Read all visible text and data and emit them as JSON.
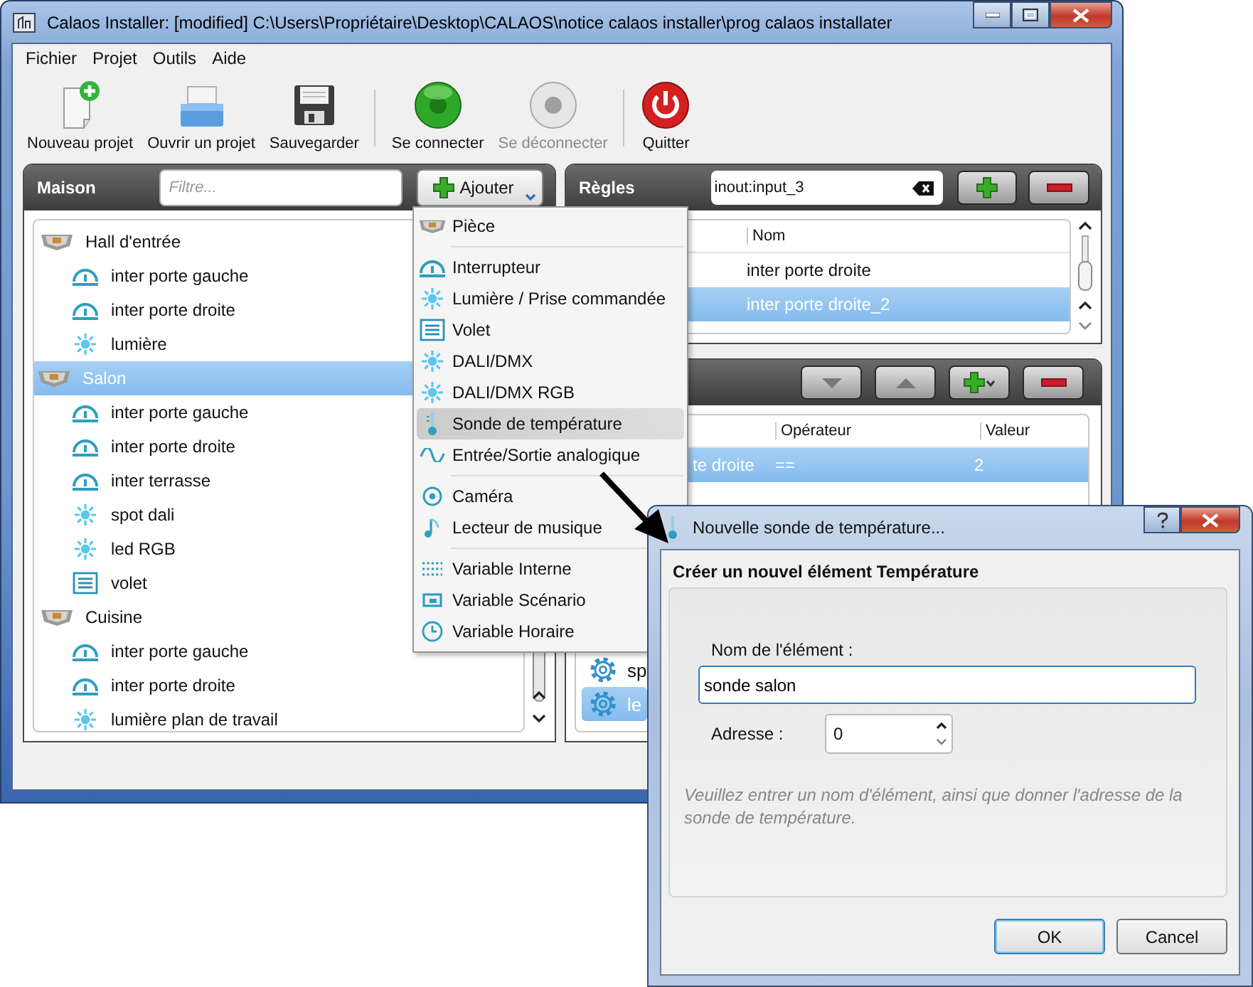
{
  "window": {
    "title": "Calaos Installer: [modified] C:\\Users\\Propriétaire\\Desktop\\CALAOS\\notice calaos installer\\prog calaos installater"
  },
  "menu_bar": [
    "Fichier",
    "Projet",
    "Outils",
    "Aide"
  ],
  "toolbar": [
    {
      "label": "Nouveau projet",
      "kind": "new",
      "separator_before": false,
      "disabled": false
    },
    {
      "label": "Ouvrir un projet",
      "kind": "open",
      "separator_before": false,
      "disabled": false
    },
    {
      "label": "Sauvegarder",
      "kind": "save",
      "separator_before": false,
      "disabled": false
    },
    {
      "label": "Se connecter",
      "kind": "connect",
      "separator_before": true,
      "disabled": false
    },
    {
      "label": "Se déconnecter",
      "kind": "disconnect",
      "separator_before": false,
      "disabled": true
    },
    {
      "label": "Quitter",
      "kind": "quit",
      "separator_before": true,
      "disabled": false
    }
  ],
  "house_panel": {
    "title": "Maison",
    "filter": {
      "placeholder": "Filtre..."
    },
    "add_button": "Ajouter",
    "tree": [
      {
        "label": "Hall d'entrée",
        "kind": "room",
        "selected": false,
        "children": [
          {
            "label": "inter porte gauche",
            "kind": "switch",
            "selected": false
          },
          {
            "label": "inter porte droite",
            "kind": "switch",
            "selected": false
          },
          {
            "label": "lumière",
            "kind": "light",
            "selected": false
          }
        ]
      },
      {
        "label": "Salon",
        "kind": "room",
        "selected": true,
        "children": [
          {
            "label": "inter porte gauche",
            "kind": "switch",
            "selected": false
          },
          {
            "label": "inter porte droite",
            "kind": "switch",
            "selected": false
          },
          {
            "label": "inter terrasse",
            "kind": "switch",
            "selected": false
          },
          {
            "label": "spot dali",
            "kind": "light",
            "selected": false
          },
          {
            "label": "led RGB",
            "kind": "light",
            "selected": false
          },
          {
            "label": "volet",
            "kind": "shutter",
            "selected": false
          }
        ]
      },
      {
        "label": "Cuisine",
        "kind": "room",
        "selected": false,
        "children": [
          {
            "label": "inter porte gauche",
            "kind": "switch",
            "selected": false
          },
          {
            "label": "inter porte droite",
            "kind": "switch",
            "selected": false
          },
          {
            "label": "lumière plan de travail",
            "kind": "light",
            "selected": false
          }
        ]
      }
    ]
  },
  "add_menu": [
    {
      "label": "Pièce",
      "kind": "room",
      "separator_before": false,
      "selected": false
    },
    {
      "label": "Interrupteur",
      "kind": "switch",
      "separator_before": true,
      "selected": false
    },
    {
      "label": "Lumière / Prise commandée",
      "kind": "light",
      "separator_before": false,
      "selected": false
    },
    {
      "label": "Volet",
      "kind": "shutter",
      "separator_before": false,
      "selected": false
    },
    {
      "label": "DALI/DMX",
      "kind": "light",
      "separator_before": false,
      "selected": false
    },
    {
      "label": "DALI/DMX RGB",
      "kind": "light",
      "separator_before": false,
      "selected": false
    },
    {
      "label": "Sonde de température",
      "kind": "temp",
      "separator_before": false,
      "selected": true
    },
    {
      "label": "Entrée/Sortie analogique",
      "kind": "analog",
      "separator_before": false,
      "selected": false
    },
    {
      "label": "Caméra",
      "kind": "camera",
      "separator_before": true,
      "selected": false
    },
    {
      "label": "Lecteur de musique",
      "kind": "music",
      "separator_before": false,
      "selected": false
    },
    {
      "label": "Variable Interne",
      "kind": "var_int",
      "separator_before": true,
      "selected": false
    },
    {
      "label": "Variable Scénario",
      "kind": "var_scenario",
      "separator_before": false,
      "selected": false
    },
    {
      "label": "Variable Horaire",
      "kind": "var_time",
      "separator_before": false,
      "selected": false
    }
  ],
  "rules_panel": {
    "title": "Règles",
    "search": {
      "value": "inout:input_3"
    },
    "table": {
      "columns": [
        "Nom"
      ],
      "rows": [
        {
          "name": "inter porte droite",
          "selected": false
        },
        {
          "name": "inter porte droite_2",
          "selected": true
        }
      ]
    }
  },
  "conditions_panel": {
    "table": {
      "columns": [
        "Opérateur",
        "Valeur"
      ],
      "rows": [
        {
          "column_1": "te droite",
          "operator": "==",
          "value": "2",
          "selected": true
        }
      ]
    },
    "actions": [
      {
        "label": "sp",
        "selected": false
      },
      {
        "label": "le",
        "selected": true
      }
    ]
  },
  "dialog": {
    "title": "Nouvelle sonde de température...",
    "heading": "Créer un nouvel élément Température",
    "name_label": "Nom de l'élément :",
    "name_value": "sonde salon",
    "address_label": "Adresse :",
    "address_value": "0",
    "hint": "Veuillez entrer un nom d'élément, ainsi que donner l'adresse de la sonde de température.",
    "buttons": [
      {
        "label": "OK",
        "default": true
      },
      {
        "label": "Cancel",
        "default": false
      }
    ]
  }
}
